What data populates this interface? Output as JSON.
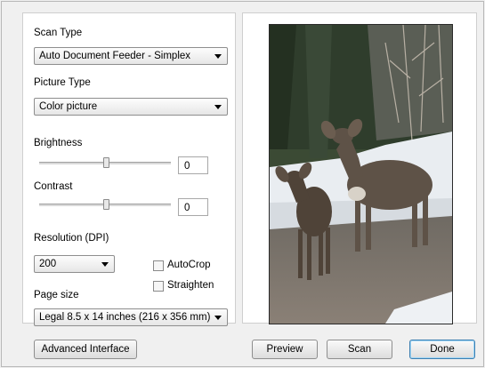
{
  "scan_type": {
    "label": "Scan Type",
    "value": "Auto Document Feeder - Simplex"
  },
  "picture_type": {
    "label": "Picture Type",
    "value": "Color picture"
  },
  "brightness": {
    "label": "Brightness",
    "value": "0"
  },
  "contrast": {
    "label": "Contrast",
    "value": "0"
  },
  "resolution": {
    "label": "Resolution (DPI)",
    "value": "200"
  },
  "autocrop": {
    "label": "AutoCrop",
    "checked": false
  },
  "straighten": {
    "label": "Straighten",
    "checked": false
  },
  "page_size": {
    "label": "Page size",
    "value": "Legal 8.5 x 14 inches (216 x 356 mm)"
  },
  "buttons": {
    "advanced": "Advanced Interface",
    "preview": "Preview",
    "scan": "Scan",
    "done": "Done"
  },
  "preview_image": {
    "subject": "deer-photo"
  }
}
